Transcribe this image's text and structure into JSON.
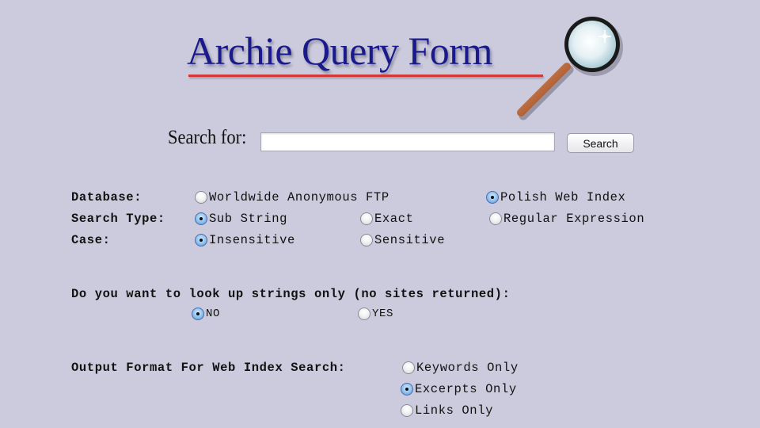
{
  "header": {
    "title": "Archie Query Form",
    "logo_icon": "magnifying-glass-icon",
    "colors": {
      "title": "#1a1a8c",
      "underline": "#d23a3a",
      "background": "#cccbdd"
    }
  },
  "search": {
    "label": "Search for:",
    "value": "",
    "placeholder": "",
    "button_label": "Search"
  },
  "options": {
    "database": {
      "label": "Database:",
      "choices": [
        {
          "label": "Worldwide Anonymous FTP",
          "checked": false
        },
        {
          "label": "Polish Web Index",
          "checked": true
        }
      ]
    },
    "search_type": {
      "label": "Search Type:",
      "choices": [
        {
          "label": "Sub String",
          "checked": true
        },
        {
          "label": "Exact",
          "checked": false
        },
        {
          "label": "Regular Expression",
          "checked": false
        }
      ]
    },
    "case": {
      "label": "Case:",
      "choices": [
        {
          "label": "Insensitive",
          "checked": true
        },
        {
          "label": "Sensitive",
          "checked": false
        }
      ]
    },
    "strings_only": {
      "label": "Do you want to look up strings only (no sites returned):",
      "choices": [
        {
          "label": "NO",
          "checked": true
        },
        {
          "label": "YES",
          "checked": false
        }
      ]
    },
    "output_format": {
      "label": "Output Format For Web Index Search:",
      "choices": [
        {
          "label": "Keywords Only",
          "checked": false
        },
        {
          "label": "Excerpts Only",
          "checked": true
        },
        {
          "label": "Links Only",
          "checked": false
        }
      ]
    }
  }
}
